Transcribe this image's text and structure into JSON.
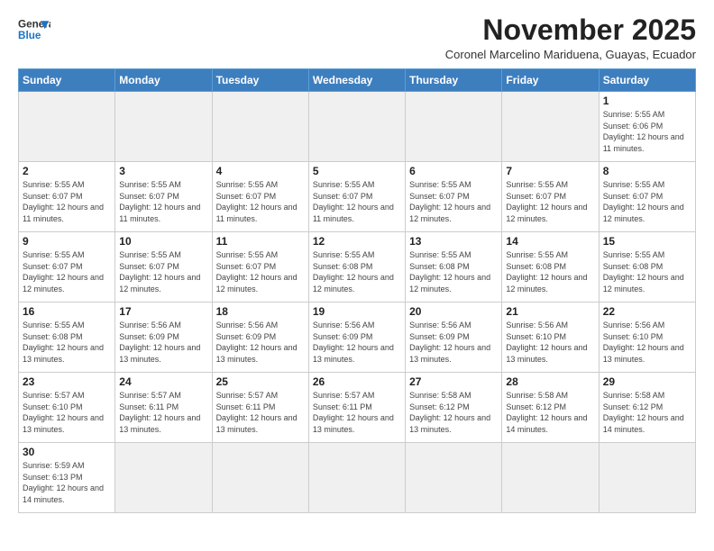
{
  "logo": {
    "line1": "General",
    "line2": "Blue"
  },
  "title": "November 2025",
  "subtitle": "Coronel Marcelino Mariduena, Guayas, Ecuador",
  "weekdays": [
    "Sunday",
    "Monday",
    "Tuesday",
    "Wednesday",
    "Thursday",
    "Friday",
    "Saturday"
  ],
  "weeks": [
    [
      {
        "day": "",
        "info": ""
      },
      {
        "day": "",
        "info": ""
      },
      {
        "day": "",
        "info": ""
      },
      {
        "day": "",
        "info": ""
      },
      {
        "day": "",
        "info": ""
      },
      {
        "day": "",
        "info": ""
      },
      {
        "day": "1",
        "info": "Sunrise: 5:55 AM\nSunset: 6:06 PM\nDaylight: 12 hours and 11 minutes."
      }
    ],
    [
      {
        "day": "2",
        "info": "Sunrise: 5:55 AM\nSunset: 6:07 PM\nDaylight: 12 hours and 11 minutes."
      },
      {
        "day": "3",
        "info": "Sunrise: 5:55 AM\nSunset: 6:07 PM\nDaylight: 12 hours and 11 minutes."
      },
      {
        "day": "4",
        "info": "Sunrise: 5:55 AM\nSunset: 6:07 PM\nDaylight: 12 hours and 11 minutes."
      },
      {
        "day": "5",
        "info": "Sunrise: 5:55 AM\nSunset: 6:07 PM\nDaylight: 12 hours and 11 minutes."
      },
      {
        "day": "6",
        "info": "Sunrise: 5:55 AM\nSunset: 6:07 PM\nDaylight: 12 hours and 12 minutes."
      },
      {
        "day": "7",
        "info": "Sunrise: 5:55 AM\nSunset: 6:07 PM\nDaylight: 12 hours and 12 minutes."
      },
      {
        "day": "8",
        "info": "Sunrise: 5:55 AM\nSunset: 6:07 PM\nDaylight: 12 hours and 12 minutes."
      }
    ],
    [
      {
        "day": "9",
        "info": "Sunrise: 5:55 AM\nSunset: 6:07 PM\nDaylight: 12 hours and 12 minutes."
      },
      {
        "day": "10",
        "info": "Sunrise: 5:55 AM\nSunset: 6:07 PM\nDaylight: 12 hours and 12 minutes."
      },
      {
        "day": "11",
        "info": "Sunrise: 5:55 AM\nSunset: 6:07 PM\nDaylight: 12 hours and 12 minutes."
      },
      {
        "day": "12",
        "info": "Sunrise: 5:55 AM\nSunset: 6:08 PM\nDaylight: 12 hours and 12 minutes."
      },
      {
        "day": "13",
        "info": "Sunrise: 5:55 AM\nSunset: 6:08 PM\nDaylight: 12 hours and 12 minutes."
      },
      {
        "day": "14",
        "info": "Sunrise: 5:55 AM\nSunset: 6:08 PM\nDaylight: 12 hours and 12 minutes."
      },
      {
        "day": "15",
        "info": "Sunrise: 5:55 AM\nSunset: 6:08 PM\nDaylight: 12 hours and 12 minutes."
      }
    ],
    [
      {
        "day": "16",
        "info": "Sunrise: 5:55 AM\nSunset: 6:08 PM\nDaylight: 12 hours and 13 minutes."
      },
      {
        "day": "17",
        "info": "Sunrise: 5:56 AM\nSunset: 6:09 PM\nDaylight: 12 hours and 13 minutes."
      },
      {
        "day": "18",
        "info": "Sunrise: 5:56 AM\nSunset: 6:09 PM\nDaylight: 12 hours and 13 minutes."
      },
      {
        "day": "19",
        "info": "Sunrise: 5:56 AM\nSunset: 6:09 PM\nDaylight: 12 hours and 13 minutes."
      },
      {
        "day": "20",
        "info": "Sunrise: 5:56 AM\nSunset: 6:09 PM\nDaylight: 12 hours and 13 minutes."
      },
      {
        "day": "21",
        "info": "Sunrise: 5:56 AM\nSunset: 6:10 PM\nDaylight: 12 hours and 13 minutes."
      },
      {
        "day": "22",
        "info": "Sunrise: 5:56 AM\nSunset: 6:10 PM\nDaylight: 12 hours and 13 minutes."
      }
    ],
    [
      {
        "day": "23",
        "info": "Sunrise: 5:57 AM\nSunset: 6:10 PM\nDaylight: 12 hours and 13 minutes."
      },
      {
        "day": "24",
        "info": "Sunrise: 5:57 AM\nSunset: 6:11 PM\nDaylight: 12 hours and 13 minutes."
      },
      {
        "day": "25",
        "info": "Sunrise: 5:57 AM\nSunset: 6:11 PM\nDaylight: 12 hours and 13 minutes."
      },
      {
        "day": "26",
        "info": "Sunrise: 5:57 AM\nSunset: 6:11 PM\nDaylight: 12 hours and 13 minutes."
      },
      {
        "day": "27",
        "info": "Sunrise: 5:58 AM\nSunset: 6:12 PM\nDaylight: 12 hours and 13 minutes."
      },
      {
        "day": "28",
        "info": "Sunrise: 5:58 AM\nSunset: 6:12 PM\nDaylight: 12 hours and 14 minutes."
      },
      {
        "day": "29",
        "info": "Sunrise: 5:58 AM\nSunset: 6:12 PM\nDaylight: 12 hours and 14 minutes."
      }
    ],
    [
      {
        "day": "30",
        "info": "Sunrise: 5:59 AM\nSunset: 6:13 PM\nDaylight: 12 hours and 14 minutes."
      },
      {
        "day": "",
        "info": ""
      },
      {
        "day": "",
        "info": ""
      },
      {
        "day": "",
        "info": ""
      },
      {
        "day": "",
        "info": ""
      },
      {
        "day": "",
        "info": ""
      },
      {
        "day": "",
        "info": ""
      }
    ]
  ]
}
